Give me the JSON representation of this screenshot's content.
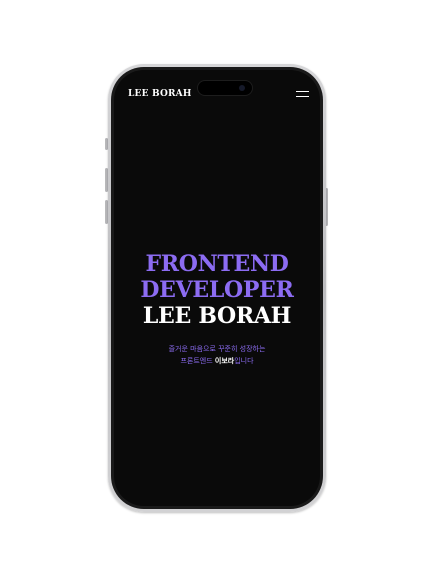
{
  "header": {
    "logo": "LEE BORAH",
    "menu_icon": "hamburger-menu-icon"
  },
  "hero": {
    "line1": "FRONTEND",
    "line2": "DEVELOPER",
    "line3": "LEE BORAH",
    "tagline_line1": "즐거운 마음으로 꾸준히 성장하는",
    "tagline_prefix": "프론트엔드 ",
    "tagline_name": "이보라",
    "tagline_suffix": "입니다"
  },
  "colors": {
    "accent": "#8c6cf2",
    "screen_background": "#0a0a0a",
    "text": "#ffffff",
    "page_background": "#ffffff"
  }
}
